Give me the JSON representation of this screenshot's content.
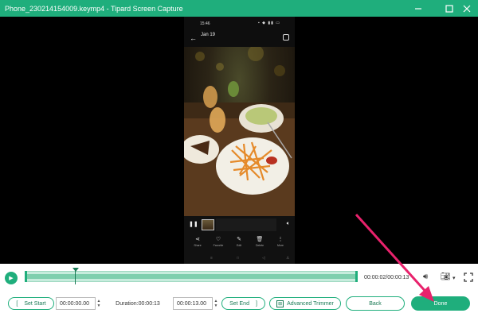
{
  "window": {
    "title": "Phone_230214154009.keymp4  -  Tipard Screen Capture",
    "minimize_icon": "minimize-icon",
    "maximize_icon": "maximize-icon",
    "close_icon": "close-icon",
    "accent": "#1fae7c"
  },
  "phone": {
    "status_time": "15:46",
    "header_date": "Jan 19",
    "header_time": "",
    "actions": [
      {
        "icon": "share-icon",
        "label": "Share"
      },
      {
        "icon": "heart-icon",
        "label": "Favorite"
      },
      {
        "icon": "edit-icon",
        "label": "Edit"
      },
      {
        "icon": "trash-icon",
        "label": "Delete"
      },
      {
        "icon": "more-icon",
        "label": "More"
      }
    ]
  },
  "player": {
    "timecode": "00:00:02/00:00:13",
    "progress_fraction": 0.15
  },
  "trim": {
    "set_start_label": "Set Start",
    "start_value": "00:00:00.00",
    "duration_label": "Duration:00:00:13",
    "end_value": "00:00:13.00",
    "set_end_label": "Set End",
    "advanced_trimmer_label": "Advanced Trimmer",
    "back_label": "Back",
    "done_label": "Done"
  },
  "annotation": {
    "arrow_color": "#e8226c"
  }
}
